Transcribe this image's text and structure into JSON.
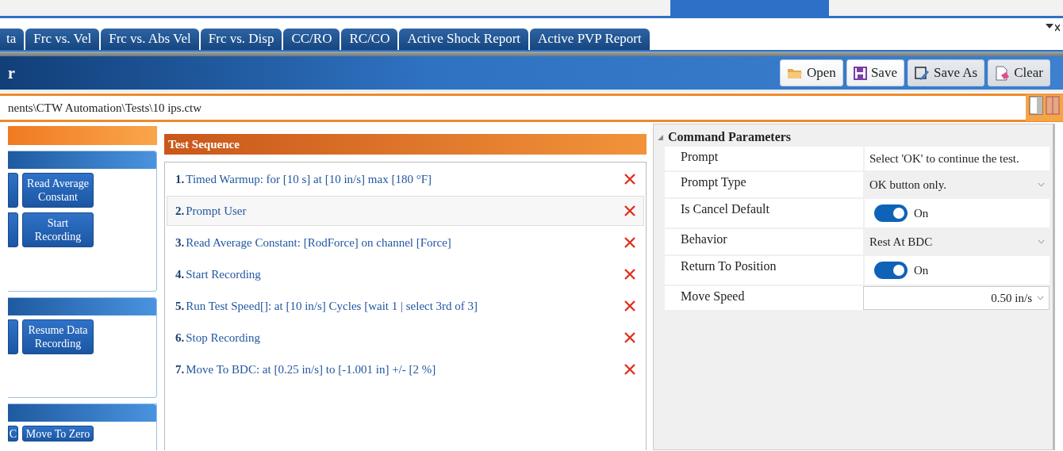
{
  "tabs": [
    {
      "label": "ta"
    },
    {
      "label": "Frc vs. Vel"
    },
    {
      "label": "Frc vs. Abs Vel"
    },
    {
      "label": "Frc vs. Disp"
    },
    {
      "label": "CC/RO"
    },
    {
      "label": "RC/CO"
    },
    {
      "label": "Active Shock Report"
    },
    {
      "label": "Active PVP Report"
    }
  ],
  "header": {
    "title": "r",
    "buttons": [
      {
        "label": "Open"
      },
      {
        "label": "Save"
      },
      {
        "label": "Save As"
      },
      {
        "label": "Clear"
      }
    ]
  },
  "path": "nents\\CTW Automation\\Tests\\10 ips.ctw",
  "sidebar": {
    "groups": [
      {
        "rows": [
          [
            {
              "kind": "clipped"
            },
            {
              "kind": "command",
              "label": "Read Average Constant"
            }
          ],
          [
            {
              "kind": "clipped"
            },
            {
              "kind": "command",
              "label": "Start Recording"
            }
          ]
        ]
      },
      {
        "rows": [
          [
            {
              "kind": "clipped"
            },
            {
              "kind": "command",
              "label": "Resume Data Recording"
            }
          ]
        ]
      },
      {
        "rows": [
          [
            {
              "kind": "clipped",
              "label": "C"
            },
            {
              "kind": "command",
              "label": "Move To Zero"
            }
          ]
        ]
      }
    ]
  },
  "sequence": {
    "title": "Test Sequence",
    "items": [
      {
        "number": "1.",
        "text": "Timed Warmup: for [10 s] at [10 in/s] max [180 °F]",
        "selected": false
      },
      {
        "number": "2.",
        "text": "Prompt User",
        "selected": true
      },
      {
        "number": "3.",
        "text": "Read Average Constant: [RodForce] on channel [Force]",
        "selected": false
      },
      {
        "number": "4.",
        "text": "Start Recording",
        "selected": false
      },
      {
        "number": "5.",
        "text": "Run Test Speed[]: at [10 in/s] Cycles [wait 1 | select 3rd of 3]",
        "selected": false
      },
      {
        "number": "6.",
        "text": "Stop Recording",
        "selected": false
      },
      {
        "number": "7.",
        "text": "Move To BDC: at [0.25 in/s] to [-1.001 in] +/- [2 %]",
        "selected": false
      }
    ]
  },
  "parameters": {
    "title": "Command Parameters",
    "expanded": true,
    "rows": [
      {
        "kind": "text",
        "label": "Prompt",
        "value": "Select 'OK' to continue the test."
      },
      {
        "kind": "dropdown",
        "label": "Prompt Type",
        "value": "OK button only."
      },
      {
        "kind": "toggle",
        "label": "Is Cancel Default",
        "on": true,
        "value": "On"
      },
      {
        "kind": "dropdown",
        "label": "Behavior",
        "value": "Rest At BDC"
      },
      {
        "kind": "toggle",
        "label": "Return To Position",
        "on": true,
        "value": "On"
      },
      {
        "kind": "number",
        "label": "Move Speed",
        "value": "0.50 in/s"
      }
    ]
  }
}
